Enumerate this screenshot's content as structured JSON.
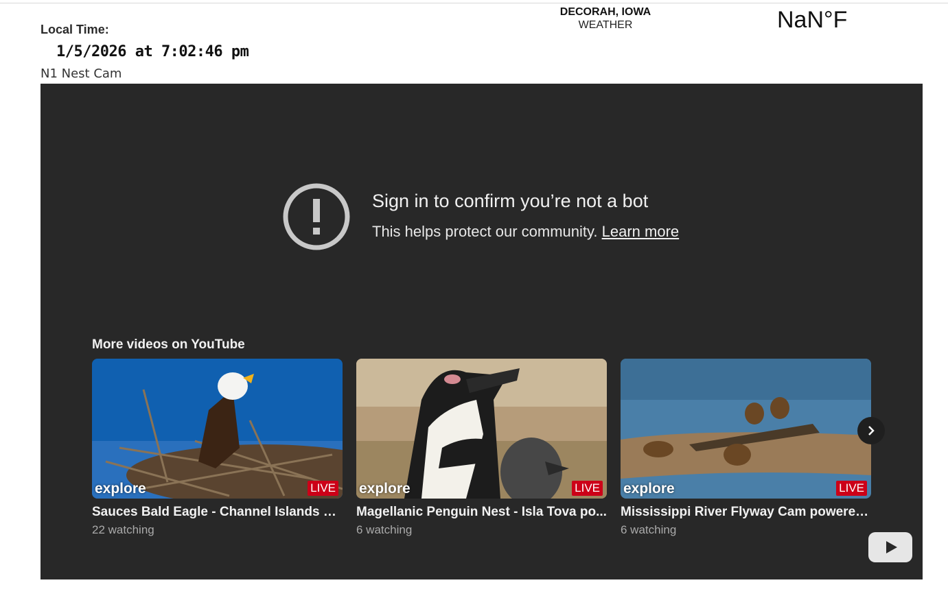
{
  "header": {
    "local_time_label": "Local Time:",
    "local_time_value": "1/5/2026 at 7:02:46 pm",
    "cam_name": "N1 Nest Cam",
    "weather_location": "DECORAH, IOWA",
    "weather_label": "WEATHER",
    "temperature": "NaN°F"
  },
  "player": {
    "message_title": "Sign in to confirm you’re not a bot",
    "message_sub": "This helps protect our community.",
    "learn_more": "Learn more",
    "more_videos_title": "More videos on YouTube",
    "videos": [
      {
        "title": "Sauces Bald Eagle - Channel Islands N...",
        "meta": "22 watching",
        "brand": "explore",
        "badge": "LIVE"
      },
      {
        "title": "Magellanic Penguin Nest - Isla Tova po...",
        "meta": "6 watching",
        "brand": "explore",
        "badge": "LIVE"
      },
      {
        "title": "Mississippi River Flyway Cam powered...",
        "meta": "6 watching",
        "brand": "explore",
        "badge": "LIVE"
      }
    ],
    "icons": {
      "warning": "exclamation-circle-icon",
      "next": "chevron-right-icon",
      "logo": "youtube-logo-icon"
    }
  },
  "colors": {
    "player_bg": "#282828",
    "live_badge": "#cc0018",
    "meta_text": "#aaaaaa"
  }
}
